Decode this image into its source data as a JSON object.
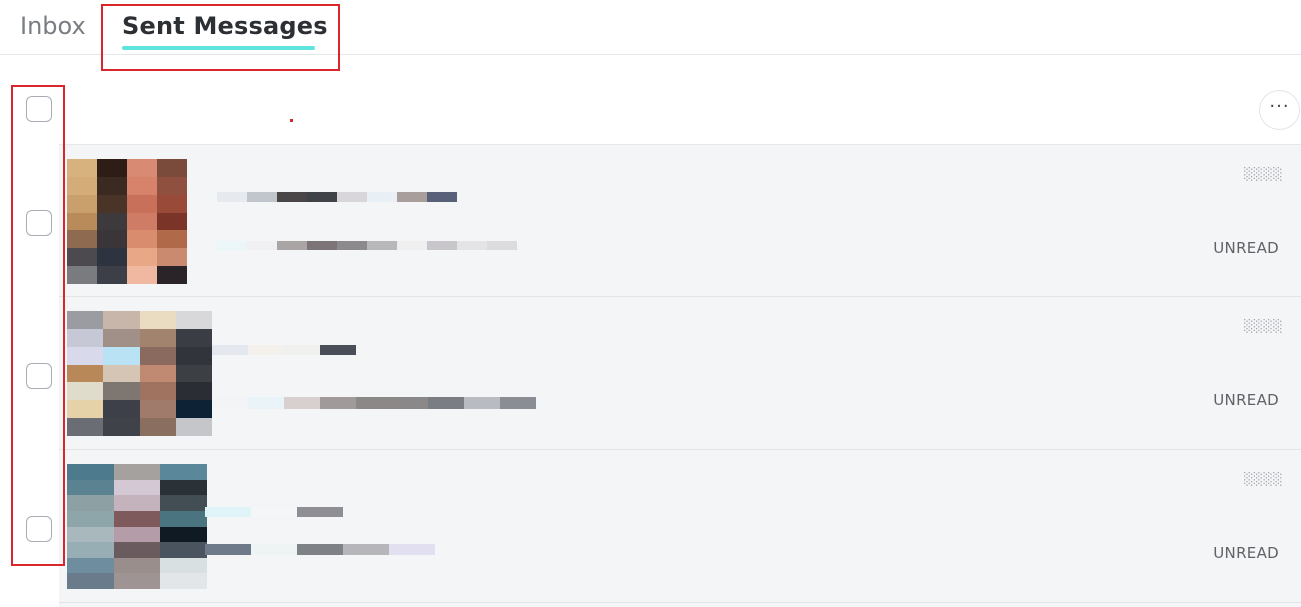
{
  "tabs": {
    "inbox_label": "Inbox",
    "sent_label": "Sent Messages",
    "active": "Sent Messages"
  },
  "header": {
    "more_label": "···"
  },
  "messages": [
    {
      "status": "UNREAD"
    },
    {
      "status": "UNREAD"
    },
    {
      "status": "UNREAD"
    }
  ],
  "colors": {
    "accent_underline": "#5de4dc",
    "annotation": "#d9262c",
    "row_bg": "#f4f5f7"
  }
}
